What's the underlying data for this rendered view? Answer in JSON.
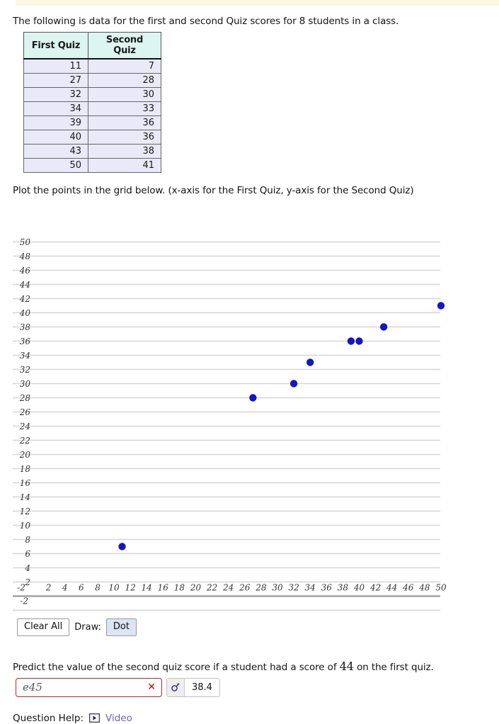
{
  "intro": "The following is data for the first and second Quiz scores for 8 students in a class.",
  "table": {
    "headers": [
      "First Quiz",
      "Second Quiz"
    ],
    "rows": [
      [
        "11",
        "7"
      ],
      [
        "27",
        "28"
      ],
      [
        "32",
        "30"
      ],
      [
        "34",
        "33"
      ],
      [
        "39",
        "36"
      ],
      [
        "40",
        "36"
      ],
      [
        "43",
        "38"
      ],
      [
        "50",
        "41"
      ]
    ]
  },
  "plot_instruction": "Plot the points in the grid below. (x-axis for the First Quiz, y-axis for the Second Quiz)",
  "chart_data": {
    "type": "scatter",
    "title": "",
    "xlabel": "",
    "ylabel": "",
    "xlim": [
      -3,
      51
    ],
    "ylim": [
      -3,
      51
    ],
    "xticks": [
      -2,
      2,
      4,
      6,
      8,
      10,
      12,
      14,
      16,
      18,
      20,
      22,
      24,
      26,
      28,
      30,
      32,
      34,
      36,
      38,
      40,
      42,
      44,
      46,
      48,
      50
    ],
    "yticks": [
      -2,
      2,
      4,
      6,
      8,
      10,
      12,
      14,
      16,
      18,
      20,
      22,
      24,
      26,
      28,
      30,
      32,
      34,
      36,
      38,
      40,
      42,
      44,
      46,
      48,
      50
    ],
    "grid": true,
    "legend": "none",
    "point_color": "#1414c8",
    "gridline_color": "#d6d6d6",
    "axis_color": "#8c8c8c",
    "points": [
      {
        "x": 11,
        "y": 7
      },
      {
        "x": 27,
        "y": 28
      },
      {
        "x": 32,
        "y": 30
      },
      {
        "x": 34,
        "y": 33
      },
      {
        "x": 39,
        "y": 36
      },
      {
        "x": 40,
        "y": 36
      },
      {
        "x": 43,
        "y": 38
      },
      {
        "x": 50,
        "y": 41
      }
    ]
  },
  "tools": {
    "clear_all_label": "Clear All",
    "draw_label": "Draw:",
    "dot_label": "Dot"
  },
  "predict": {
    "text_before": "Predict the value of the second quiz score if a student had a score of ",
    "score": "44",
    "text_after": " on the first quiz.",
    "input_value": "e45",
    "preview_value": "38.4"
  },
  "help": {
    "label": "Question Help:",
    "video_label": "Video"
  }
}
